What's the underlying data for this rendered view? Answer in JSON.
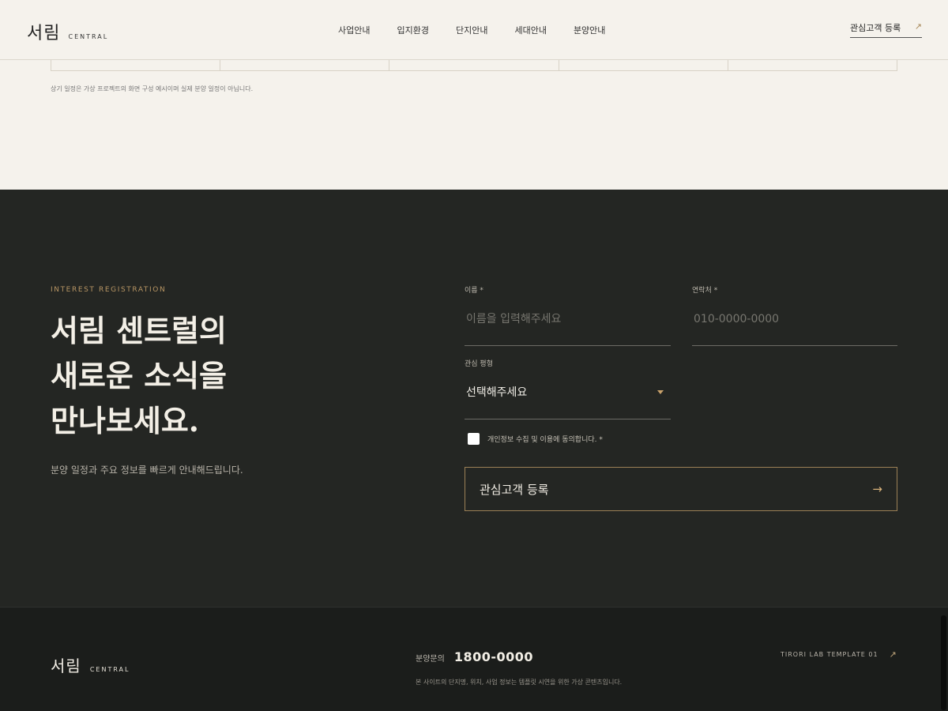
{
  "header": {
    "logo_main": "서림",
    "logo_sub": "CENTRAL",
    "nav": [
      "사업안내",
      "입지환경",
      "단지안내",
      "세대안내",
      "분양안내"
    ],
    "cta_label": "관심고객 등록",
    "cta_icon": "arrow-up-right-icon"
  },
  "schedule": {
    "note": "상기 일정은 가상 프로젝트의 화면 구성 예시이며 실제 분양 일정이 아닙니다."
  },
  "registration": {
    "eyebrow": "INTEREST REGISTRATION",
    "title_lines": [
      "서림 센트럴의",
      "새로운 소식을",
      "만나보세요."
    ],
    "description": "분양 일정과 주요 정보를 빠르게 안내해드립니다.",
    "name_label": "이름 *",
    "name_placeholder": "이름을 입력해주세요",
    "phone_label": "연락처 *",
    "phone_placeholder": "010-0000-0000",
    "type_label": "관심 평형",
    "type_selected": "선택해주세요",
    "consent_label": "개인정보 수집 및 이용에 동의합니다. *",
    "consent_checked": false,
    "submit_label": "관심고객 등록",
    "submit_icon": "arrow-right-icon"
  },
  "footer": {
    "logo_main": "서림",
    "logo_sub": "CENTRAL",
    "contact_label": "분양문의",
    "contact_phone": "1800-0000",
    "note": "본 사이트의 단지명, 위치, 사업 정보는 템플릿 시연을 위한 가상 콘텐츠입니다.",
    "link_label": "TIRORI LAB TEMPLATE 01",
    "link_icon": "arrow-up-right-icon"
  },
  "colors": {
    "accent": "#b99664",
    "dark_bg": "#242623",
    "footer_bg": "#1b1d1b",
    "light_bg": "#f5f2ec"
  }
}
